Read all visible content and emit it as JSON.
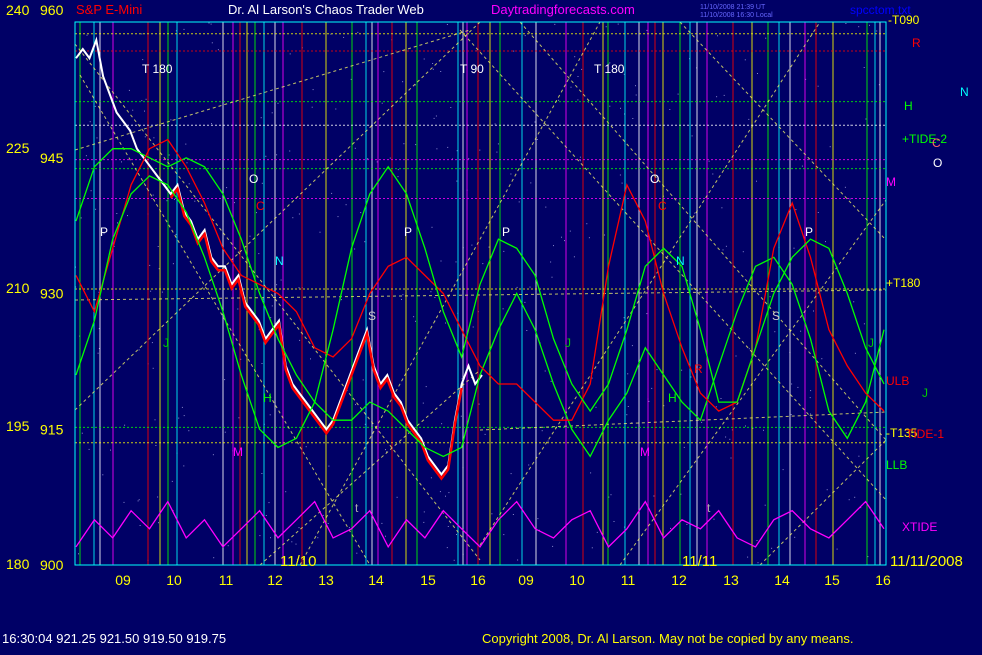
{
  "header": {
    "symbol": "S&P E-Mini",
    "title": "Dr. Al Larson's Chaos Trader Web",
    "site": "Daytradingforecasts.com",
    "ts1": "11/10/2008 21:39 UT",
    "ts2": "11/10/2008 16:30 Local",
    "file": "spcctom.txt"
  },
  "footer": {
    "quote": "16:30:04  921.25 921.50 919.50 919.75",
    "copyright": "Copyright 2008, Dr. Al Larson. May not be copied by any means."
  },
  "colors": {
    "background": "#000066",
    "axis_text": "#ffff00",
    "frame": "#00ffff",
    "price": "#ffffff",
    "price_low": "#ff0000"
  },
  "chart_data": {
    "type": "line",
    "y_left": {
      "ticks": [
        240,
        225,
        210,
        195,
        180
      ]
    },
    "y_right": {
      "ticks": [
        960,
        945,
        930,
        915,
        900
      ],
      "ylim": [
        900,
        960
      ]
    },
    "x_hours": [
      "09",
      "10",
      "11",
      "12",
      "13",
      "14",
      "15",
      "16",
      "09",
      "10",
      "11",
      "12",
      "13",
      "14",
      "15",
      "16"
    ],
    "date_labels": [
      "11/10",
      "11/11",
      "11/11/2008"
    ],
    "right_labels": [
      {
        "text": "-T090",
        "color": "#ffff00"
      },
      {
        "text": "R",
        "color": "#ff0000"
      },
      {
        "text": "H",
        "color": "#00ff00"
      },
      {
        "text": "N",
        "color": "#00ffff"
      },
      {
        "text": "+TIDE-2",
        "color": "#00ff00"
      },
      {
        "text": "C",
        "color": "#ff6666"
      },
      {
        "text": "O",
        "color": "#ffffff"
      },
      {
        "text": "M",
        "color": "#ff00ff"
      },
      {
        "text": "+T180",
        "color": "#ffff00"
      },
      {
        "text": "ULB",
        "color": "#ff0000"
      },
      {
        "text": "J",
        "color": "#00cc00"
      },
      {
        "text": "-T135",
        "color": "#ffff00"
      },
      {
        "text": "TIDE-1",
        "color": "#ff0000"
      },
      {
        "text": "LLB",
        "color": "#00ff00"
      },
      {
        "text": "XTIDE",
        "color": "#ff00ff"
      }
    ],
    "markers": [
      {
        "text": "T 180",
        "color": "#ffffff"
      },
      {
        "text": "T 90",
        "color": "#ffffff"
      },
      {
        "text": "T 180",
        "color": "#ffffff"
      },
      {
        "text": "P",
        "color": "#ffffff"
      },
      {
        "text": "O",
        "color": "#ffffff"
      },
      {
        "text": "C",
        "color": "#ff0000"
      },
      {
        "text": "N",
        "color": "#00ffff"
      },
      {
        "text": "S",
        "color": "#cccccc"
      },
      {
        "text": "P",
        "color": "#ffffff"
      },
      {
        "text": "J",
        "color": "#00cc00"
      },
      {
        "text": "H",
        "color": "#00ff00"
      },
      {
        "text": "M",
        "color": "#ff00ff"
      },
      {
        "text": "P",
        "color": "#ffffff"
      },
      {
        "text": "O",
        "color": "#ffffff"
      },
      {
        "text": "C",
        "color": "#ff0000"
      },
      {
        "text": "N",
        "color": "#00ffff"
      },
      {
        "text": "J",
        "color": "#00cc00"
      },
      {
        "text": "H",
        "color": "#00ff00"
      },
      {
        "text": "R",
        "color": "#ff0000"
      },
      {
        "text": "S",
        "color": "#cccccc"
      },
      {
        "text": "P",
        "color": "#ffffff"
      },
      {
        "text": "M",
        "color": "#ff00ff"
      },
      {
        "text": "J",
        "color": "#00cc00"
      },
      {
        "text": "t",
        "color": "#aaaaaa"
      },
      {
        "text": "t",
        "color": "#aaaaaa"
      }
    ],
    "series": [
      {
        "kind": "price",
        "color": "#ffffff",
        "values": [
          956,
          957,
          956,
          958,
          954,
          952,
          950,
          949,
          948,
          946,
          945,
          944,
          943,
          942,
          941,
          942,
          939,
          938,
          936,
          937,
          934,
          933,
          933,
          931,
          932,
          929,
          928,
          927,
          925,
          926,
          927,
          922,
          920,
          919,
          918,
          917,
          916,
          915,
          916,
          918,
          920,
          922,
          924,
          926,
          922,
          920,
          921,
          919,
          918,
          916,
          915,
          914,
          912,
          911,
          910,
          911,
          916,
          920,
          922,
          920,
          921
        ]
      },
      {
        "kind": "LLB",
        "color": "#00ff00",
        "values": [
          938,
          944,
          946,
          946,
          945,
          944,
          945,
          944,
          941,
          936,
          930,
          925,
          921,
          918,
          916,
          916,
          918,
          917,
          915,
          913,
          912,
          913,
          921,
          926,
          930,
          926,
          920,
          915,
          912,
          916,
          919,
          924,
          921,
          918,
          916,
          922,
          928,
          933,
          934,
          931,
          925,
          917,
          914,
          918,
          926
        ]
      },
      {
        "kind": "ULB",
        "color": "#ff0000",
        "values": [
          932,
          928,
          935,
          942,
          946,
          947,
          944,
          940,
          935,
          932,
          931,
          930,
          928,
          924,
          923,
          925,
          930,
          933,
          934,
          932,
          930,
          926,
          922,
          920,
          920,
          918,
          916,
          916,
          920,
          933,
          942,
          938,
          930,
          924,
          919,
          917,
          918,
          924,
          935,
          940,
          934,
          926,
          922,
          919,
          917
        ]
      },
      {
        "kind": "TIDE-2",
        "color": "#00ff00",
        "values": [
          921,
          927,
          936,
          941,
          943,
          942,
          939,
          934,
          928,
          921,
          915,
          913,
          914,
          918,
          926,
          935,
          941,
          944,
          941,
          935,
          928,
          923,
          931,
          936,
          935,
          932,
          925,
          920,
          917,
          920,
          926,
          933,
          935,
          933,
          926,
          918,
          918,
          924,
          930,
          934,
          936,
          935,
          930,
          924,
          920
        ]
      },
      {
        "kind": "XTIDE",
        "color": "#ff00ff",
        "values": [
          902,
          905,
          903,
          906,
          904,
          907,
          903,
          905,
          902,
          904,
          906,
          903,
          905,
          907,
          903,
          904,
          906,
          902,
          905,
          903,
          906,
          904,
          902,
          905,
          907,
          904,
          903,
          905,
          906,
          902,
          904,
          907,
          903,
          905,
          904,
          906,
          903,
          902,
          905,
          906,
          904,
          903,
          905,
          907,
          904
        ]
      }
    ]
  }
}
